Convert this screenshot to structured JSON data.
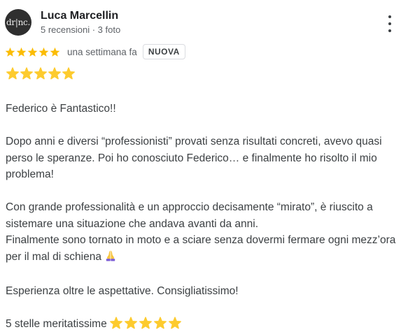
{
  "author": {
    "name": "Luca Marcellin",
    "avatar_text": "dr|nc.",
    "meta": "5 recensioni · 3 foto"
  },
  "rating": {
    "stars": 5,
    "date": "una settimana fa",
    "badge": "NUOVA",
    "star_color": "#fbbc04"
  },
  "review": {
    "emoji_star_count": 5,
    "p1": "Federico è Fantastico!!",
    "p2": "Dopo anni e diversi “professionisti” provati senza risultati concreti, avevo quasi perso le speranze. Poi ho conosciuto Federico… e finalmente ho risolto il mio problema!",
    "p3a": "Con grande professionalità e un approccio decisamente “mirato”, è riuscito a sistemare una situazione che andava avanti da anni.",
    "p3b": "Finalmente sono tornato in moto e a sciare senza dovermi fermare ogni mezz’ora per il mal di schiena",
    "p3b_icon": "folded-hands-icon",
    "p4": "Esperienza oltre le aspettative. Consigliatissimo!",
    "p5": "5 stelle meritatissime",
    "p5_icon": "star-icon",
    "emoji_star_color": "#fdcb2e"
  },
  "menu": {
    "icon": "more-vert-icon"
  }
}
